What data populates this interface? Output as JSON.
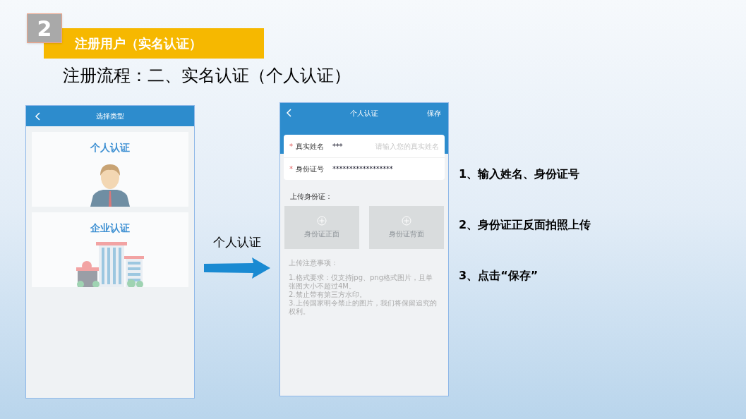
{
  "slide": {
    "step_number": "2",
    "section_title": "注册用户（实名认证）",
    "heading": "注册流程：二、实名认证（个人认证）"
  },
  "screen_1": {
    "title": "选择类型",
    "options": [
      {
        "label": "个人认证",
        "kind": "person"
      },
      {
        "label": "企业认证",
        "kind": "company"
      }
    ]
  },
  "arrow_label": "个人认证",
  "screen_2": {
    "title": "个人认证",
    "action": "保存",
    "fields": [
      {
        "label": "真实姓名",
        "required_mark": "*",
        "value": "***",
        "placeholder": "请输入您的真实姓名"
      },
      {
        "label": "身份证号",
        "required_mark": "*",
        "value": "******************"
      }
    ],
    "upload_label": "上传身份证：",
    "upload_slots": [
      "身份证正面",
      "身份证背面"
    ],
    "notes_title": "上传注意事项：",
    "notes": [
      "1.格式要求：仅支持jpg、png格式图片，且单张图大小不超过4M。",
      "2.禁止带有第三方水印。",
      "3.上传国家明令禁止的图片，我们将保留追究的权利。"
    ]
  },
  "steps": [
    "1、输入姓名、身份证号",
    "2、身份证正反面拍照上传",
    "3、点击“保存”"
  ]
}
